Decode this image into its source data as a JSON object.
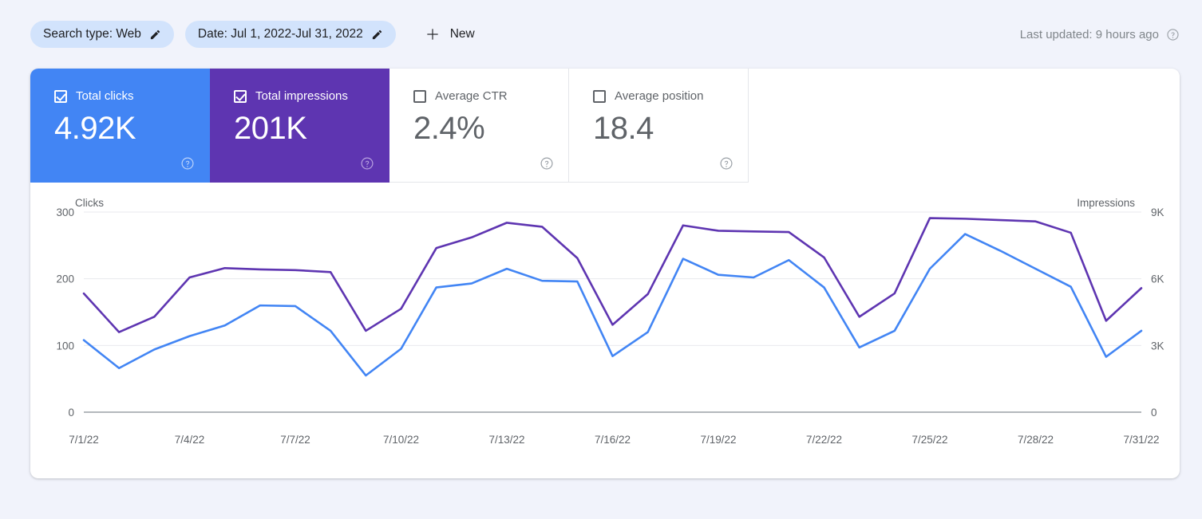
{
  "toolbar": {
    "search_type_chip": "Search type: Web",
    "date_chip": "Date: Jul 1, 2022-Jul 31, 2022",
    "new_label": "New",
    "last_updated": "Last updated: 9 hours ago"
  },
  "cards": [
    {
      "label": "Total clicks",
      "value": "4.92K",
      "checked": true,
      "color": "#4285f4"
    },
    {
      "label": "Total impressions",
      "value": "201K",
      "checked": true,
      "color": "#5e35b1"
    },
    {
      "label": "Average CTR",
      "value": "2.4%",
      "checked": false,
      "color": "#ffffff"
    },
    {
      "label": "Average position",
      "value": "18.4",
      "checked": false,
      "color": "#ffffff"
    }
  ],
  "chart_data": {
    "type": "line",
    "title": "",
    "left_axis_label": "Clicks",
    "right_axis_label": "Impressions",
    "left_ticks": [
      "300",
      "200",
      "100",
      "0"
    ],
    "right_ticks": [
      "9K",
      "6K",
      "3K",
      "0"
    ],
    "left_ylim": [
      0,
      300
    ],
    "right_ylim": [
      0,
      9000
    ],
    "grid": true,
    "legend_position": "cards-above",
    "x": [
      "7/1/22",
      "7/2/22",
      "7/3/22",
      "7/4/22",
      "7/5/22",
      "7/6/22",
      "7/7/22",
      "7/8/22",
      "7/9/22",
      "7/10/22",
      "7/11/22",
      "7/12/22",
      "7/13/22",
      "7/14/22",
      "7/15/22",
      "7/16/22",
      "7/17/22",
      "7/18/22",
      "7/19/22",
      "7/20/22",
      "7/21/22",
      "7/22/22",
      "7/23/22",
      "7/24/22",
      "7/25/22",
      "7/26/22",
      "7/27/22",
      "7/28/22",
      "7/29/22",
      "7/30/22",
      "7/31/22"
    ],
    "xtick_labels": [
      "7/1/22",
      "7/4/22",
      "7/7/22",
      "7/10/22",
      "7/13/22",
      "7/16/22",
      "7/19/22",
      "7/22/22",
      "7/25/22",
      "7/28/22",
      "7/31/22"
    ],
    "series": [
      {
        "name": "Total clicks",
        "color": "#4285f4",
        "axis": "left",
        "values": [
          108,
          66,
          94,
          114,
          130,
          160,
          159,
          122,
          55,
          95,
          187,
          193,
          215,
          197,
          196,
          84,
          120,
          230,
          206,
          202,
          228,
          187,
          97,
          122,
          215,
          267,
          242,
          215,
          188,
          83,
          122
        ]
      },
      {
        "name": "Total impressions",
        "color": "#5e35b1",
        "axis": "right",
        "values": [
          5340,
          3600,
          4290,
          6060,
          6480,
          6420,
          6390,
          6300,
          3660,
          4650,
          7380,
          7860,
          8520,
          8340,
          6930,
          3930,
          5310,
          8400,
          8160,
          8130,
          8100,
          6960,
          4290,
          5340,
          8730,
          8700,
          8640,
          8580,
          8070,
          4110,
          5580
        ]
      }
    ]
  }
}
